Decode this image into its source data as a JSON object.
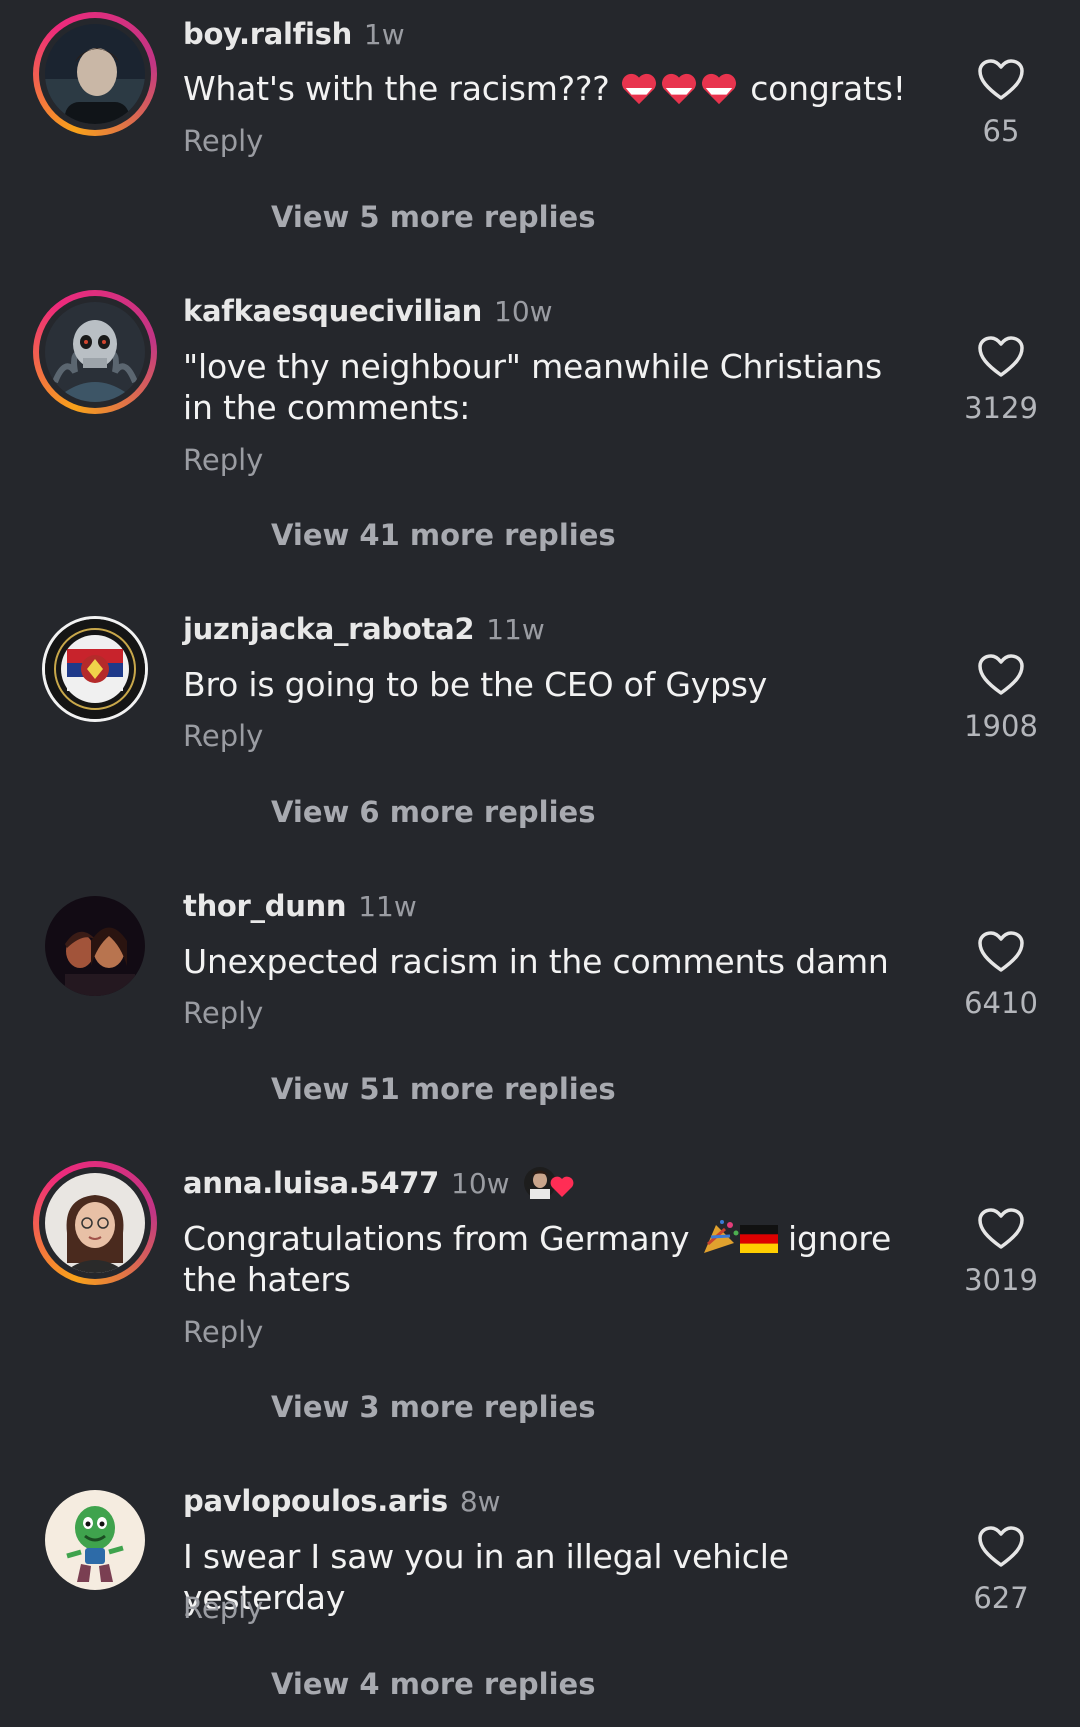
{
  "comments": [
    {
      "username": "boy.ralfish",
      "time": "1w",
      "text_before": "What's with the racism???",
      "text_after": "congrats!",
      "emojis": [
        "heart-emoji",
        "heart-emoji",
        "heart-emoji"
      ],
      "reply_label": "Reply",
      "likes": "65",
      "view_replies": "View 5 more replies",
      "avatar_ring": "story"
    },
    {
      "username": "kafkaesquecivilian",
      "time": "10w",
      "text": "\"love thy neighbour\" meanwhile Christians in the comments:",
      "reply_label": "Reply",
      "likes": "3129",
      "view_replies": "View 41 more replies",
      "avatar_ring": "story"
    },
    {
      "username": "juznjacka_rabota2",
      "time": "11w",
      "text": "Bro is going to be the CEO of Gypsy",
      "reply_label": "Reply",
      "likes": "1908",
      "view_replies": "View 6 more replies",
      "avatar_ring": "none"
    },
    {
      "username": "thor_dunn",
      "time": "11w",
      "text": "Unexpected racism in the comments damn",
      "reply_label": "Reply",
      "likes": "6410",
      "view_replies": "View 51 more replies",
      "avatar_ring": "none"
    },
    {
      "username": "anna.luisa.5477",
      "time": "10w",
      "text_before": "Congratulations from Germany",
      "text_after": "ignore the haters",
      "emojis": [
        "confetti-emoji",
        "germany-flag-emoji"
      ],
      "reply_label": "Reply",
      "likes": "3019",
      "view_replies": "View 3 more replies",
      "avatar_ring": "story",
      "creator_liked": true
    },
    {
      "username": "pavlopoulos.aris",
      "time": "8w",
      "text": "I swear I saw you in an illegal vehicle yesterday",
      "reply_label": "Reply",
      "likes": "627",
      "view_replies": "View 4 more replies",
      "avatar_ring": "none"
    }
  ],
  "theme": {
    "background": "#25272c",
    "text": "#f2f2f2",
    "muted": "#9a9ca2",
    "story_ring": [
      "#f8a21a",
      "#ee2a7b",
      "#c13584"
    ],
    "heart_emoji_red": "#e8344e",
    "heart_emoji_white": "#ffffff"
  }
}
